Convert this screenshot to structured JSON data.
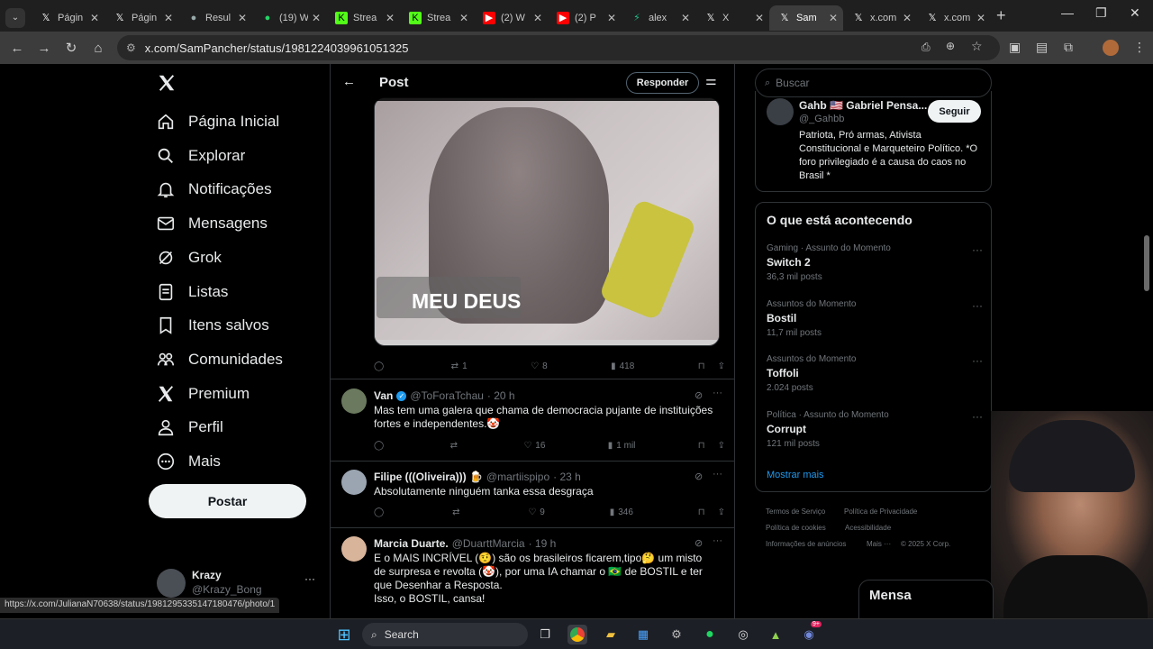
{
  "browser": {
    "tabs": [
      {
        "icon": "x-icon",
        "title": "Págin"
      },
      {
        "icon": "x-icon",
        "title": "Págin"
      },
      {
        "icon": "circle-icon",
        "title": "Resul"
      },
      {
        "icon": "whatsapp-icon",
        "title": "(19) W"
      },
      {
        "icon": "kick-icon",
        "title": "Strea"
      },
      {
        "icon": "kick-icon",
        "title": "Strea"
      },
      {
        "icon": "youtube-icon",
        "title": "(2) W"
      },
      {
        "icon": "youtube-icon",
        "title": "(2) P"
      },
      {
        "icon": "bolt-icon",
        "title": "alex"
      },
      {
        "icon": "x-icon",
        "title": "X"
      },
      {
        "icon": "x-icon",
        "title": "Sam"
      },
      {
        "icon": "x-icon",
        "title": "x.com"
      },
      {
        "icon": "x-icon",
        "title": "x.com"
      }
    ],
    "active_tab_index": 10,
    "url": "x.com/SamPancher/status/1981224039961051325"
  },
  "nav": {
    "items": [
      {
        "icon": "home-icon",
        "label": "Página Inicial"
      },
      {
        "icon": "search-icon",
        "label": "Explorar"
      },
      {
        "icon": "bell-icon",
        "label": "Notificações"
      },
      {
        "icon": "mail-icon",
        "label": "Mensagens"
      },
      {
        "icon": "grok-icon",
        "label": "Grok"
      },
      {
        "icon": "list-icon",
        "label": "Listas"
      },
      {
        "icon": "bookmark-icon",
        "label": "Itens salvos"
      },
      {
        "icon": "communities-icon",
        "label": "Comunidades"
      },
      {
        "icon": "x-icon",
        "label": "Premium"
      },
      {
        "icon": "person-icon",
        "label": "Perfil"
      },
      {
        "icon": "more-circle-icon",
        "label": "Mais"
      }
    ],
    "post_button": "Postar",
    "account": {
      "name": "Krazy",
      "handle": "@Krazy_Bong"
    }
  },
  "header": {
    "title": "Post",
    "reply_button": "Responder"
  },
  "main_post": {
    "image_caption": "MEU DEUS",
    "stats": {
      "replies": "",
      "reposts": "1",
      "likes": "8",
      "views": "418"
    }
  },
  "replies": [
    {
      "name": "Van",
      "verified": true,
      "handle": "@ToForaTchau",
      "time": "· 20 h",
      "text": "Mas tem uma galera que chama de democracia pujante de instituições fortes e independentes.🤡",
      "stats": {
        "replies": "",
        "reposts": "",
        "likes": "16",
        "views": "1 mil"
      }
    },
    {
      "name": "Filipe (((Oliveira))) 🍺",
      "verified": false,
      "handle": "@martiispipo",
      "time": "· 23 h",
      "text": "Absolutamente ninguém tanka essa desgraça",
      "stats": {
        "replies": "",
        "reposts": "",
        "likes": "9",
        "views": "346"
      }
    },
    {
      "name": "Marcia Duarte.",
      "verified": false,
      "handle": "@DuarttMarcia",
      "time": "· 19 h",
      "text": "E o MAIS INCRÍVEL (🤨)  são os brasileiros ficarem,tipo🤔 um misto de surpresa e revolta (🤡), por uma IA chamar o 🇧🇷 de BOSTIL e ter que Desenhar a Resposta.\nIsso, o BOSTIL, cansa!",
      "stats": {
        "replies": "",
        "reposts": "",
        "likes": "",
        "views": ""
      }
    }
  ],
  "right": {
    "search_placeholder": "Buscar",
    "follow_card": {
      "name": "Gahb 🇺🇸 Gabriel Pensa...",
      "handle": "@_Gahbb",
      "bio": "Patriota, Pró armas, Ativista Constitucional e Marqueteiro Político. *O foro privilegiado é a causa do caos no Brasil *",
      "follow_button": "Seguir"
    },
    "trends_title": "O que está acontecendo",
    "trends": [
      {
        "category": "Gaming · Assunto do Momento",
        "name": "Switch 2",
        "count": "36,3 mil posts"
      },
      {
        "category": "Assuntos do Momento",
        "name": "Bostil",
        "count": "11,7 mil posts"
      },
      {
        "category": "Assuntos do Momento",
        "name": "Toffoli",
        "count": "2.024 posts"
      },
      {
        "category": "Política · Assunto do Momento",
        "name": "Corrupt",
        "count": "121 mil posts"
      }
    ],
    "show_more": "Mostrar mais",
    "footer": [
      "Termos de Serviço",
      "Política de Privacidade",
      "Política de cookies",
      "Acessibilidade",
      "Informações de anúncios",
      "Mais ···",
      "© 2025 X Corp."
    ],
    "messages_label": "Mensa"
  },
  "status_url": "https://x.com/JulianaN70638/status/1981295335147180476/photo/1",
  "taskbar": {
    "search_placeholder": "Search",
    "discord_badge": "9+"
  },
  "colors": {
    "accent": "#1d9bf0",
    "text": "#e7e9ea",
    "muted": "#71767b",
    "border": "#2f3336"
  }
}
